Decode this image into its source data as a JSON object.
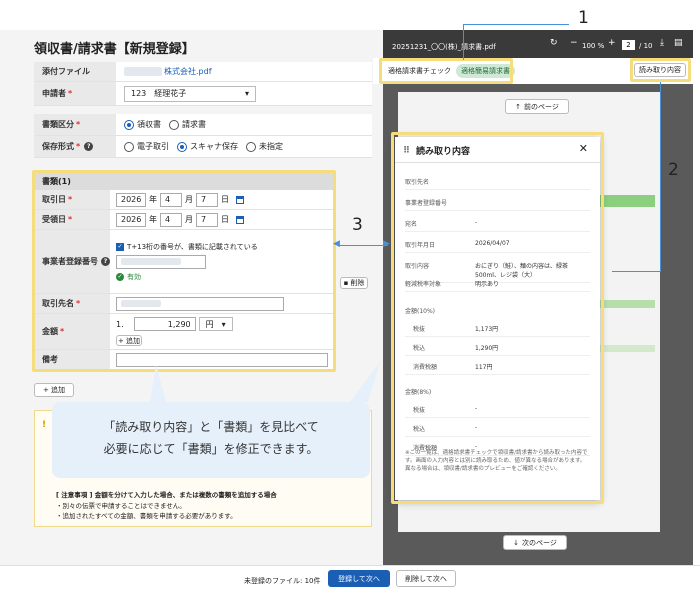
{
  "form": {
    "title": "領収書/請求書【新規登録】",
    "attachment_label": "添付ファイル",
    "attachment_value": "株式会社.pdf",
    "applicant_label": "申請者",
    "applicant_value": "123　経理花子",
    "doc_type_label": "書類区分",
    "doc_type_options": [
      "領収書",
      "請求書"
    ],
    "storage_label": "保存形式",
    "storage_options": [
      "電子取引",
      "スキャナ保存",
      "未指定"
    ],
    "doc_section_title": "書類(1)",
    "txn_date_label": "取引日",
    "txn_date": {
      "year": "2026",
      "y": "年",
      "month": "4",
      "m": "月",
      "day": "7",
      "d": "日"
    },
    "recv_date_label": "受領日",
    "recv_date": {
      "year": "2026",
      "y": "年",
      "month": "4",
      "m": "月",
      "day": "7",
      "d": "日"
    },
    "reg_no_label": "事業者登録番号",
    "reg_no_checkbox": "T+13桁の番号が、書類に記載されている",
    "reg_no_status": "有効",
    "delete_label": "削除",
    "partner_label": "取引先名",
    "amount_label": "金額",
    "amount_index": "1.",
    "amount_value": "1,290",
    "currency": "円",
    "add_small": "+ 追加",
    "memo_label": "備考",
    "add_button": "+ 追加",
    "note_title": "[ 注意事項 ] 金額を分けて入力した場合、または複数の書類を追加する場合",
    "note_line1": "・別々の伝票で申請することはできません。",
    "note_line2": "・追加されたすべての金額、書類を申請する必要があります。"
  },
  "bubble": {
    "line1": "「読み取り内容」と「書類」を見比べて",
    "line2": "必要に応じて「書類」を修正できます。"
  },
  "viewer": {
    "filename": "20251231_〇〇(株)_請求書.pdf",
    "zoom": "100 %",
    "page_current": "2",
    "page_total": "/ 10",
    "check_label": "適格請求書チェック",
    "check_badge": "適格簡易請求書",
    "read_button": "読み取り内容",
    "prev_page": "前のページ",
    "next_page": "次のページ"
  },
  "read_panel": {
    "title": "読み取り内容",
    "rows": [
      {
        "k": "取引先名",
        "v": ""
      },
      {
        "k": "事業者登録番号",
        "v": ""
      },
      {
        "k": "宛名",
        "v": "-"
      },
      {
        "k": "取引年月日",
        "v": "2026/04/07"
      },
      {
        "k": "取引内容",
        "v": "おにぎり（鮭）、麺の内容は、緑茶500ml、レジ袋（大）"
      },
      {
        "k": "軽減税率対象",
        "v": "明示あり"
      }
    ],
    "section10": "金額(10%)",
    "rows10": [
      {
        "k": "税抜",
        "v": "1,173円"
      },
      {
        "k": "税込",
        "v": "1,290円"
      },
      {
        "k": "消費税額",
        "v": "117円"
      }
    ],
    "section8": "金額(8%)",
    "rows8": [
      {
        "k": "税抜",
        "v": "-"
      },
      {
        "k": "税込",
        "v": "-"
      },
      {
        "k": "消費税額",
        "v": "-"
      }
    ],
    "footnote": "※この一覧は、適格請求書チェックで領収書/請求書から読み取った内容です。画面の入力内容とは別に読み取るため、値が異なる場合があります。異なる場合は、領収書/請求書のプレビューをご確認ください。"
  },
  "footer": {
    "unregistered": "未登録のファイル: 10件",
    "register_next": "登録して次へ",
    "delete_next": "削除して次へ"
  },
  "callouts": {
    "c1": "1",
    "c2": "2",
    "c3": "3"
  }
}
